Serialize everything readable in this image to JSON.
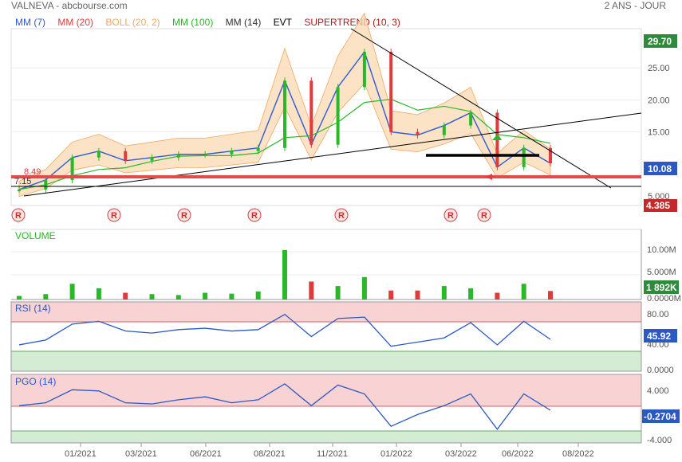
{
  "header": {
    "source": "VALNEVA - abcbourse.com",
    "period": "2 ANS - JOUR"
  },
  "legend": [
    {
      "label": "MM (7)",
      "color": "#2d5bd6"
    },
    {
      "label": "MM (20)",
      "color": "#e03a3a"
    },
    {
      "label": "BOLL (20, 2)",
      "color": "#f0a860"
    },
    {
      "label": "MM (100)",
      "color": "#2ab82a"
    },
    {
      "label": "MM (14)",
      "color": "#333333"
    },
    {
      "label": "EVT",
      "color": "#000000"
    },
    {
      "label": "SUPERTREND (10, 3)",
      "color": "#b01a1a"
    }
  ],
  "price_axis": [
    "25.00",
    "20.00",
    "15.00",
    "5.000"
  ],
  "badges": {
    "high": "29.70",
    "last": "10.08",
    "low": "4.385"
  },
  "levels": {
    "support_red": "8.49",
    "support_black": "7.15"
  },
  "event_marker": "R",
  "volume": {
    "title": "VOLUME",
    "ticks": [
      "10.00M",
      "5.000M",
      "0.0000M"
    ],
    "last_badge": "1 892K"
  },
  "rsi": {
    "title": "RSI (14)",
    "ticks": [
      "80.00",
      "40.00",
      "0.0000"
    ],
    "last_badge": "45.92"
  },
  "pgo": {
    "title": "PGO (14)",
    "ticks": [
      "4.000",
      "-4.000"
    ],
    "last_badge": "-0.2704"
  },
  "x_labels": [
    "01/2021",
    "03/2021",
    "06/2021",
    "08/2021",
    "11/2021",
    "01/2022",
    "03/2022",
    "06/2022",
    "08/2022"
  ],
  "colors": {
    "up": "#2ab82a",
    "down": "#e03a3a",
    "rsi_line": "#2b59c3",
    "overbought": "#f9d3d3",
    "oversold": "#d4ecd4",
    "band": "#fbd9b3"
  },
  "chart_data": {
    "type": "line",
    "title": "VALNEVA",
    "x": [
      "2020-11",
      "2020-12",
      "2021-01",
      "2021-02",
      "2021-03",
      "2021-04",
      "2021-05",
      "2021-06",
      "2021-07",
      "2021-08",
      "2021-09",
      "2021-10",
      "2021-11",
      "2021-12",
      "2022-01",
      "2022-02",
      "2022-03",
      "2022-04",
      "2022-05",
      "2022-06",
      "2022-07"
    ],
    "series": [
      {
        "name": "MM (7)",
        "values": [
          6.0,
          7.5,
          11.0,
          12.0,
          10.5,
          11.0,
          11.5,
          11.5,
          12.0,
          12.5,
          23.0,
          13.0,
          22.0,
          27.5,
          15.0,
          14.5,
          16.0,
          18.0,
          9.5,
          12.5,
          10.1
        ]
      }
    ],
    "volume_millions": [
      0.8,
      1.2,
      3.5,
      2.5,
      1.5,
      1.2,
      1.0,
      1.5,
      1.3,
      1.8,
      11.0,
      4.0,
      3.0,
      5.0,
      2.0,
      2.0,
      3.0,
      2.5,
      1.5,
      3.5,
      1.9
    ],
    "rsi": [
      38,
      45,
      68,
      72,
      58,
      55,
      60,
      62,
      58,
      60,
      82,
      50,
      76,
      78,
      36,
      42,
      48,
      70,
      38,
      72,
      46
    ],
    "pgo": [
      0.5,
      1.0,
      3.2,
      3.0,
      1.0,
      0.8,
      1.5,
      2.0,
      1.0,
      1.5,
      4.2,
      0.5,
      4.0,
      2.5,
      -3.0,
      -1.0,
      0.5,
      2.5,
      -3.5,
      2.5,
      -0.27
    ],
    "price_axis_range": [
      4.385,
      29.7
    ],
    "rsi_range": [
      0,
      100
    ],
    "pgo_range": [
      -5,
      5
    ]
  }
}
